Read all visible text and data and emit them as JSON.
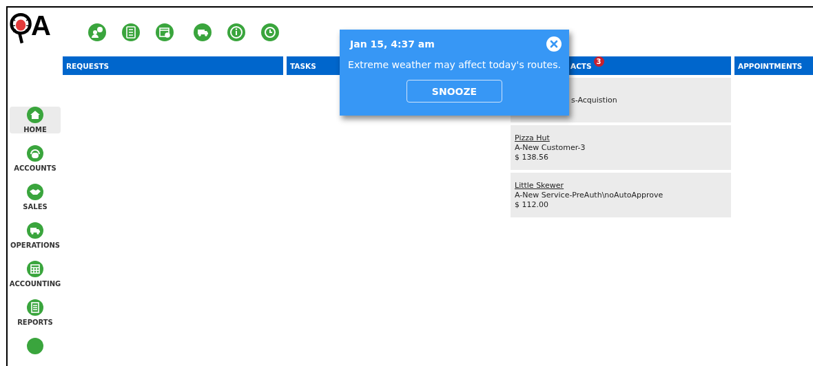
{
  "logo": {
    "text": "A"
  },
  "sidebar": {
    "items": [
      {
        "label": "HOME",
        "selected": true
      },
      {
        "label": "ACCOUNTS",
        "selected": false
      },
      {
        "label": "SALES",
        "selected": false
      },
      {
        "label": "OPERATIONS",
        "selected": false
      },
      {
        "label": "ACCOUNTING",
        "selected": false
      },
      {
        "label": "REPORTS",
        "selected": false
      }
    ]
  },
  "columns": [
    {
      "title": "REQUESTS"
    },
    {
      "title": "TASKS"
    },
    {
      "title": "ACTS",
      "badge": "3",
      "cards": [
        {
          "subtitle": "s-Acquistion"
        },
        {
          "title": "Pizza Hut",
          "subtitle": "A-New Customer-3",
          "amount": "$ 138.56"
        },
        {
          "title": "Little Skewer",
          "subtitle": "A-New Service-PreAuth\\noAutoApprove",
          "amount": "$ 112.00"
        }
      ]
    },
    {
      "title": "APPOINTMENTS"
    }
  ],
  "notification": {
    "time": "Jan 15, 4:37 am",
    "message": "Extreme weather may affect today's routes.",
    "button": "SNOOZE"
  }
}
